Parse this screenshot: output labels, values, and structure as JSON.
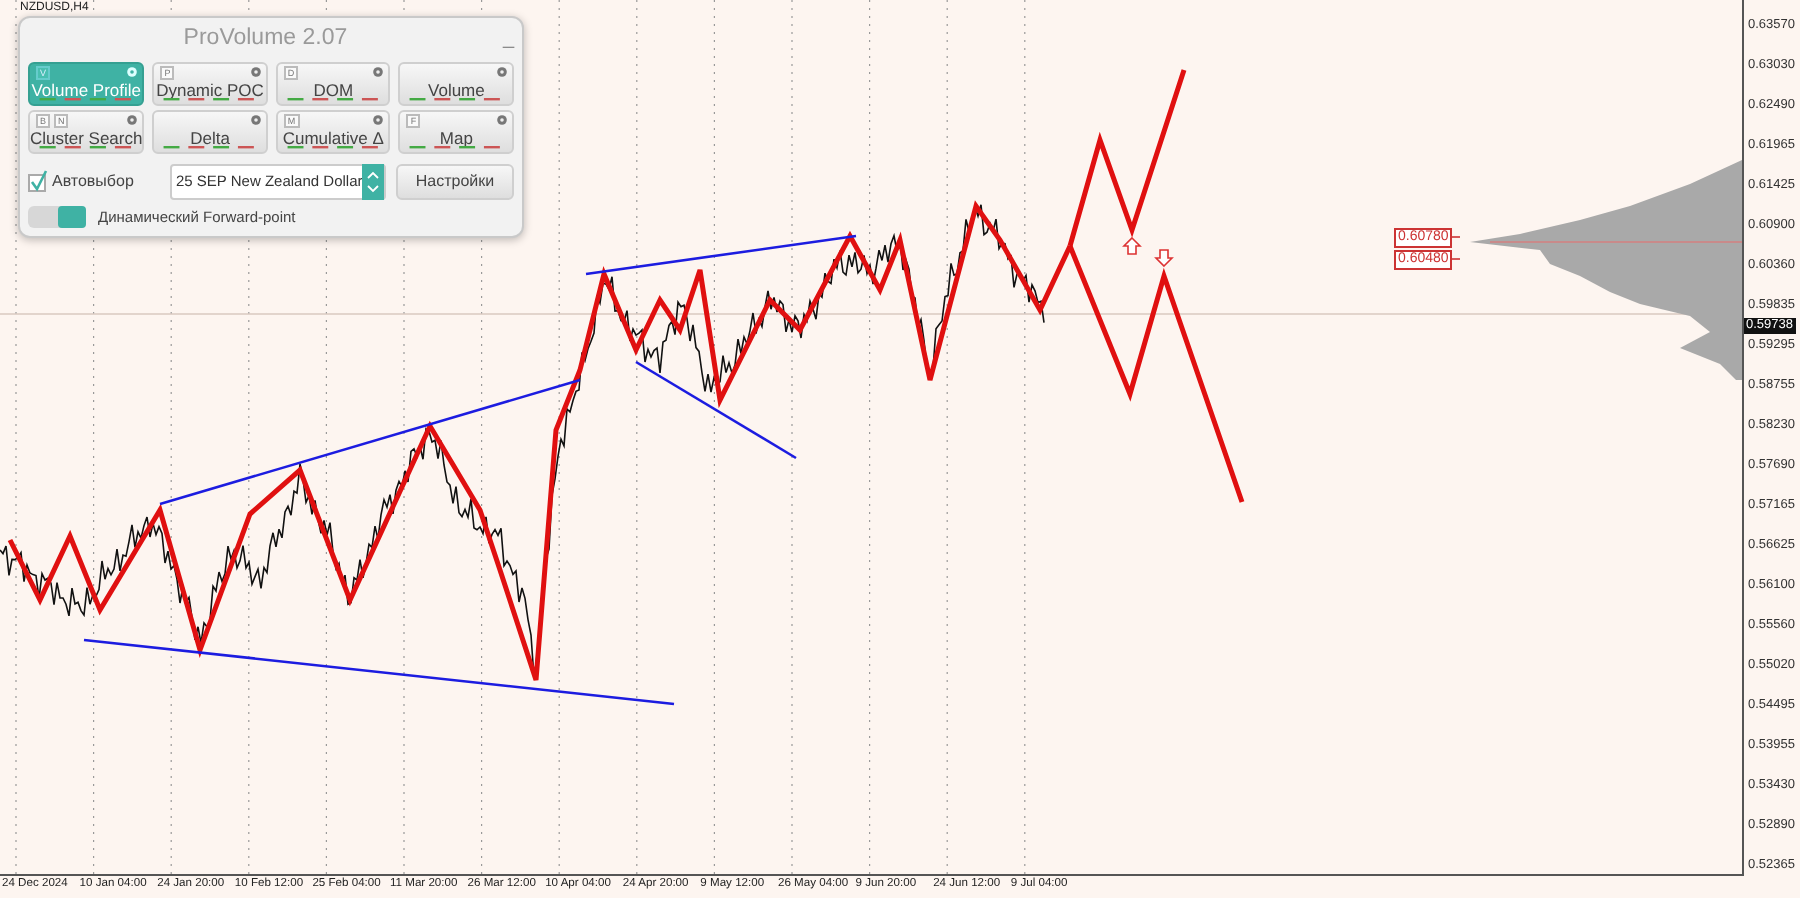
{
  "chart": {
    "symbol": "NZDUSD,H4",
    "price_tags": [
      "0.60780",
      "0.60480"
    ],
    "current_price": "0.59738",
    "price_axis": [
      "0.63570",
      "0.63030",
      "0.62490",
      "0.61965",
      "0.61425",
      "0.60900",
      "0.60360",
      "0.59835",
      "0.59295",
      "0.58755",
      "0.58230",
      "0.57690",
      "0.57165",
      "0.56625",
      "0.56100",
      "0.55560",
      "0.55020",
      "0.54495",
      "0.53955",
      "0.53430",
      "0.52890",
      "0.52365"
    ],
    "time_axis": [
      "24 Dec 2024",
      "10 Jan 04:00",
      "24 Jan 20:00",
      "10 Feb 12:00",
      "25 Feb 04:00",
      "11 Mar 20:00",
      "26 Mar 12:00",
      "10 Apr 04:00",
      "24 Apr 20:00",
      "9 May 12:00",
      "26 May 04:00",
      "9 Jun 20:00",
      "24 Jun 12:00",
      "9 Jul 04:00"
    ]
  },
  "panel": {
    "title": "ProVolume 2.07",
    "minimize": "_",
    "buttons": [
      {
        "label": "Volume Profile",
        "keys": [
          "V"
        ],
        "selected": true
      },
      {
        "label": "Dynamic POC",
        "keys": [
          "P"
        ],
        "selected": false
      },
      {
        "label": "DOM",
        "keys": [
          "D"
        ],
        "selected": false
      },
      {
        "label": "Volume",
        "selected": false
      },
      {
        "label": "Cluster Search",
        "keys": [
          "B",
          "N"
        ],
        "selected": false
      },
      {
        "label": "Delta",
        "selected": false
      },
      {
        "label": "Cumulative Δ",
        "keys": [
          "M"
        ],
        "selected": false
      },
      {
        "label": "Map",
        "keys": [
          "F"
        ],
        "selected": false
      }
    ],
    "auto_select": {
      "label": "Автовыбор",
      "checked": true
    },
    "instrument": {
      "value": "25 SEP New Zealand Dollar"
    },
    "settings_button": "Настройки",
    "forward_point": {
      "label": "Динамический Forward-point",
      "on": true
    }
  }
}
